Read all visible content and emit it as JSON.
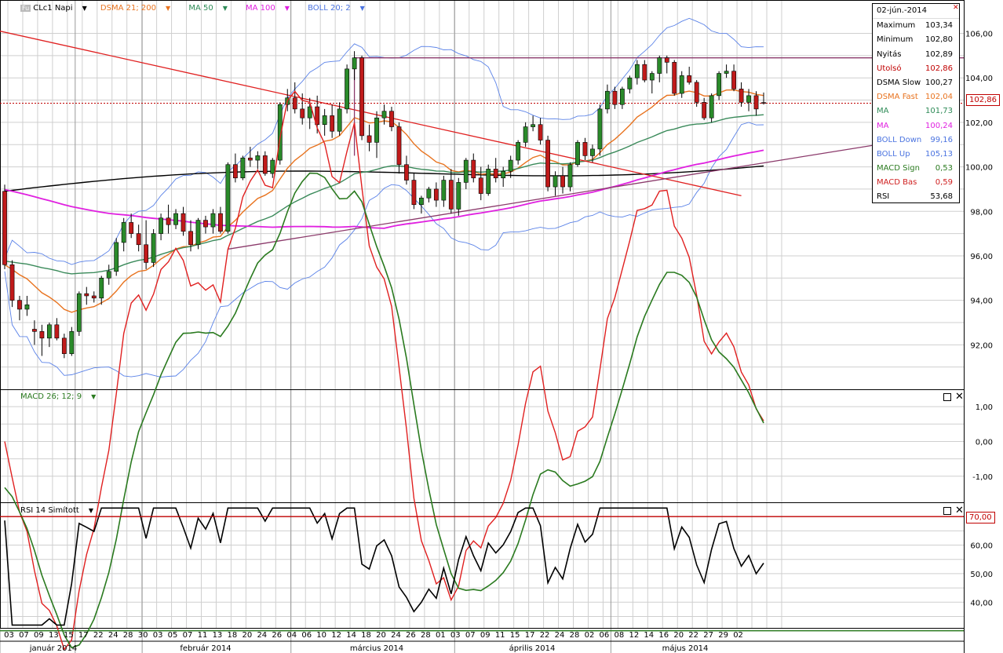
{
  "toolbar": {
    "icon_label": "Fu",
    "instrument": "CLc1 Napi",
    "indicators": [
      {
        "label": "DSMA 21; 200",
        "color": "#e8731f"
      },
      {
        "label": "MA 50",
        "color": "#2e8b57"
      },
      {
        "label": "MA 100",
        "color": "#e020e0"
      },
      {
        "label": "BOLL 20; 2",
        "color": "#4a73e0"
      }
    ]
  },
  "info_box": {
    "date": "02-jún.-2014",
    "rows": [
      {
        "label": "Maximum",
        "value": "103,34",
        "color": "#000000"
      },
      {
        "label": "Minimum",
        "value": "102,80",
        "color": "#000000"
      },
      {
        "label": "Nyitás",
        "value": "102,89",
        "color": "#000000"
      },
      {
        "label": "Utolsó",
        "value": "102,86",
        "color": "#c00000"
      },
      {
        "label": "DSMA Slow",
        "value": "100,27",
        "color": "#000000"
      },
      {
        "label": "DSMA Fast",
        "value": "102,04",
        "color": "#e8731f"
      },
      {
        "label": "MA",
        "value": "101,73",
        "color": "#2e8b57"
      },
      {
        "label": "MA",
        "value": "100,24",
        "color": "#e020e0"
      },
      {
        "label": "BOLL Down",
        "value": "99,16",
        "color": "#4a73e0"
      },
      {
        "label": "BOLL Up",
        "value": "105,13",
        "color": "#4a73e0"
      },
      {
        "label": "MACD Sign",
        "value": "0,53",
        "color": "#2a7a1f"
      },
      {
        "label": "MACD Bas",
        "value": "0,59",
        "color": "#d02020"
      },
      {
        "label": "RSI",
        "value": "53,68",
        "color": "#000000"
      }
    ]
  },
  "price_tag": "102,86",
  "rsi_level_tag": "70,00",
  "macd_panel_label": "MACD 26; 12; 9",
  "rsi_panel_label": "RSI 14 Simított",
  "chart_data": [
    {
      "type": "candlestick",
      "panel": "price",
      "ylim": [
        90,
        107.5
      ],
      "y_ticks": [
        "92,00",
        "94,00",
        "96,00",
        "98,00",
        "100,00",
        "102,00",
        "104,00",
        "106,00"
      ],
      "y_tick_values": [
        92,
        94,
        96,
        98,
        100,
        102,
        104,
        106
      ],
      "x_day_labels": [
        "03",
        "07",
        "09",
        "13",
        "15",
        "17",
        "22",
        "24",
        "28",
        "30",
        "03",
        "05",
        "07",
        "11",
        "13",
        "18",
        "20",
        "24",
        "26",
        "04",
        "06",
        "10",
        "12",
        "14",
        "18",
        "20",
        "24",
        "26",
        "28",
        "01",
        "03",
        "07",
        "09",
        "11",
        "15",
        "17",
        "22",
        "24",
        "28",
        "02",
        "06",
        "08",
        "12",
        "14",
        "16",
        "20",
        "22",
        "27",
        "29",
        "02"
      ],
      "month_labels": [
        "január 2014",
        "február 2014",
        "március 2014",
        "április 2014",
        "május 2014"
      ],
      "candles_ohlc": [
        [
          98.9,
          99.2,
          95.4,
          95.6
        ],
        [
          95.6,
          95.8,
          93.7,
          94.0
        ],
        [
          94.0,
          94.2,
          93.1,
          93.6
        ],
        [
          93.6,
          94.2,
          93.3,
          93.8
        ],
        [
          92.7,
          93.1,
          92.0,
          92.6
        ],
        [
          92.6,
          92.9,
          91.5,
          92.3
        ],
        [
          92.3,
          93.0,
          91.9,
          92.9
        ],
        [
          92.9,
          93.2,
          92.2,
          92.3
        ],
        [
          92.3,
          92.5,
          91.4,
          91.6
        ],
        [
          91.6,
          92.8,
          91.5,
          92.6
        ],
        [
          92.6,
          94.4,
          92.4,
          94.3
        ],
        [
          94.3,
          94.6,
          93.8,
          94.2
        ],
        [
          94.2,
          94.4,
          93.9,
          94.1
        ],
        [
          94.1,
          95.1,
          93.8,
          95.0
        ],
        [
          95.0,
          95.6,
          94.7,
          95.3
        ],
        [
          95.3,
          96.8,
          95.1,
          96.6
        ],
        [
          96.6,
          97.7,
          96.2,
          97.5
        ],
        [
          97.5,
          97.9,
          96.8,
          97.0
        ],
        [
          97.0,
          97.4,
          96.2,
          96.5
        ],
        [
          96.5,
          97.6,
          95.4,
          95.7
        ],
        [
          95.7,
          97.2,
          95.5,
          97.0
        ],
        [
          97.0,
          97.9,
          96.7,
          97.7
        ],
        [
          97.7,
          98.3,
          97.0,
          97.4
        ],
        [
          97.4,
          98.1,
          97.2,
          97.9
        ],
        [
          97.9,
          98.2,
          96.9,
          97.1
        ],
        [
          97.1,
          97.6,
          96.2,
          96.5
        ],
        [
          96.5,
          97.7,
          96.3,
          97.6
        ],
        [
          97.6,
          97.8,
          97.0,
          97.3
        ],
        [
          97.3,
          98.1,
          97.0,
          97.9
        ],
        [
          97.9,
          98.2,
          97.0,
          97.1
        ],
        [
          97.1,
          100.2,
          97.0,
          100.1
        ],
        [
          100.1,
          100.6,
          99.3,
          99.5
        ],
        [
          99.5,
          100.5,
          99.4,
          100.4
        ],
        [
          100.4,
          100.9,
          100.0,
          100.3
        ],
        [
          100.3,
          100.7,
          99.9,
          100.5
        ],
        [
          100.5,
          100.7,
          99.6,
          99.7
        ],
        [
          99.7,
          100.4,
          99.5,
          100.3
        ],
        [
          100.3,
          102.9,
          100.1,
          102.8
        ],
        [
          102.8,
          103.5,
          102.5,
          103.1
        ],
        [
          103.1,
          103.8,
          102.4,
          102.6
        ],
        [
          102.6,
          103.3,
          101.9,
          102.2
        ],
        [
          102.2,
          103.1,
          101.7,
          102.7
        ],
        [
          102.7,
          103.2,
          101.5,
          101.9
        ],
        [
          101.9,
          102.6,
          101.4,
          102.3
        ],
        [
          102.3,
          102.8,
          101.3,
          101.6
        ],
        [
          101.6,
          102.9,
          101.4,
          102.6
        ],
        [
          102.6,
          104.6,
          102.4,
          104.4
        ],
        [
          104.4,
          105.2,
          103.9,
          104.9
        ],
        [
          104.9,
          105.0,
          101.2,
          101.4
        ],
        [
          101.4,
          101.9,
          100.7,
          101.1
        ],
        [
          101.1,
          102.5,
          100.4,
          102.2
        ],
        [
          102.2,
          102.8,
          101.9,
          102.5
        ],
        [
          102.5,
          102.7,
          101.6,
          101.8
        ],
        [
          101.8,
          102.0,
          99.7,
          100.1
        ],
        [
          100.1,
          100.5,
          99.2,
          99.4
        ],
        [
          99.4,
          99.7,
          98.1,
          98.3
        ],
        [
          98.3,
          98.7,
          97.9,
          98.6
        ],
        [
          98.6,
          99.1,
          98.4,
          99.0
        ],
        [
          99.0,
          99.3,
          98.2,
          98.5
        ],
        [
          98.5,
          99.6,
          98.2,
          99.4
        ],
        [
          99.4,
          99.9,
          97.9,
          98.1
        ],
        [
          98.1,
          99.5,
          97.8,
          99.3
        ],
        [
          99.3,
          100.4,
          99.0,
          100.3
        ],
        [
          100.3,
          100.6,
          99.3,
          99.5
        ],
        [
          99.5,
          100.0,
          98.5,
          98.8
        ],
        [
          98.8,
          100.1,
          98.7,
          99.9
        ],
        [
          99.9,
          100.4,
          99.3,
          99.5
        ],
        [
          99.5,
          100.0,
          99.1,
          99.8
        ],
        [
          99.8,
          100.5,
          99.5,
          100.3
        ],
        [
          100.3,
          101.2,
          100.1,
          101.1
        ],
        [
          101.1,
          102.0,
          100.9,
          101.8
        ],
        [
          101.8,
          102.3,
          101.6,
          101.9
        ],
        [
          101.9,
          102.2,
          101.0,
          101.2
        ],
        [
          101.2,
          101.4,
          98.9,
          99.1
        ],
        [
          99.1,
          99.8,
          98.7,
          99.6
        ],
        [
          99.6,
          100.0,
          98.8,
          99.1
        ],
        [
          99.1,
          100.2,
          98.9,
          100.1
        ],
        [
          100.1,
          101.2,
          100.0,
          101.1
        ],
        [
          101.1,
          101.3,
          100.3,
          100.5
        ],
        [
          100.5,
          101.0,
          100.2,
          100.8
        ],
        [
          100.8,
          102.8,
          100.5,
          102.6
        ],
        [
          102.6,
          103.7,
          102.4,
          103.4
        ],
        [
          103.4,
          103.6,
          102.6,
          102.8
        ],
        [
          102.8,
          103.6,
          102.6,
          103.5
        ],
        [
          103.5,
          104.1,
          103.3,
          104.0
        ],
        [
          104.0,
          104.8,
          103.7,
          104.6
        ],
        [
          104.6,
          104.8,
          103.8,
          103.9
        ],
        [
          103.9,
          104.3,
          103.3,
          104.2
        ],
        [
          104.2,
          105.0,
          103.8,
          104.9
        ],
        [
          104.9,
          105.0,
          104.2,
          104.7
        ],
        [
          104.7,
          104.8,
          103.2,
          103.3
        ],
        [
          103.3,
          104.3,
          103.1,
          104.1
        ],
        [
          104.1,
          104.5,
          103.7,
          103.8
        ],
        [
          103.8,
          103.9,
          102.7,
          102.9
        ],
        [
          102.9,
          103.1,
          102.1,
          102.2
        ],
        [
          102.2,
          103.3,
          102.0,
          103.2
        ],
        [
          103.2,
          104.3,
          103.0,
          104.2
        ],
        [
          104.2,
          104.6,
          104.0,
          104.3
        ],
        [
          104.3,
          104.6,
          103.4,
          103.5
        ],
        [
          103.5,
          103.8,
          102.7,
          102.9
        ],
        [
          102.9,
          103.5,
          102.5,
          103.2
        ],
        [
          103.2,
          103.4,
          102.3,
          102.6
        ],
        [
          102.89,
          103.34,
          102.8,
          102.86
        ]
      ],
      "last_price": 102.86,
      "dsma_slow_last": 100.27,
      "dsma_fast_last": 102.04,
      "ma50_last": 101.73,
      "ma100_last": 100.24,
      "boll_down_last": 99.16,
      "boll_up_last": 105.13
    },
    {
      "type": "line",
      "panel": "macd",
      "ylim": [
        -1.75,
        1.5
      ],
      "y_ticks": [
        "-1,00",
        "0,00",
        "1,00"
      ],
      "y_tick_values": [
        -1,
        0,
        1
      ],
      "series": [
        {
          "name": "MACD Bas",
          "color": "#e02020",
          "last": 0.59
        },
        {
          "name": "MACD Sign",
          "color": "#2a7a1f",
          "last": 0.53
        }
      ]
    },
    {
      "type": "line",
      "panel": "rsi",
      "ylim": [
        31,
        75
      ],
      "y_ticks": [
        "40,00",
        "50,00",
        "60,00",
        "70,00"
      ],
      "y_tick_values": [
        40,
        50,
        60,
        70
      ],
      "level": 70,
      "series": [
        {
          "name": "RSI",
          "color": "#000000",
          "last": 53.68
        }
      ]
    }
  ],
  "colors": {
    "up_candle": "#2a8a2a",
    "down_candle": "#c01a1a",
    "dsma_slow": "#000000",
    "dsma_fast": "#e8731f",
    "ma50": "#3a8a5a",
    "ma100": "#e020e0",
    "boll": "#5a82e8",
    "trend_red": "#e02020",
    "trend_purple": "#8b3a6b"
  }
}
